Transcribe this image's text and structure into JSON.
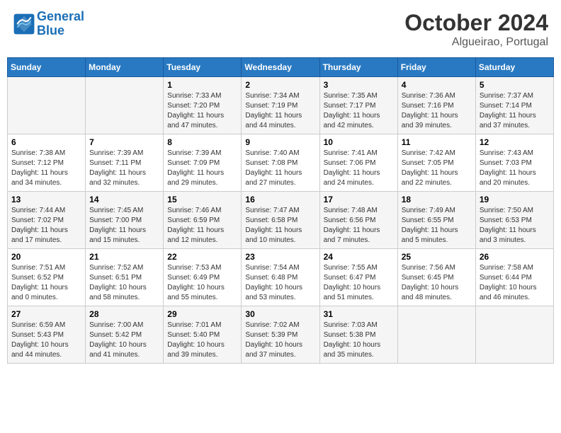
{
  "header": {
    "logo_line1": "General",
    "logo_line2": "Blue",
    "month": "October 2024",
    "location": "Algueirao, Portugal"
  },
  "days_of_week": [
    "Sunday",
    "Monday",
    "Tuesday",
    "Wednesday",
    "Thursday",
    "Friday",
    "Saturday"
  ],
  "weeks": [
    [
      {
        "day": "",
        "info": ""
      },
      {
        "day": "",
        "info": ""
      },
      {
        "day": "1",
        "info": "Sunrise: 7:33 AM\nSunset: 7:20 PM\nDaylight: 11 hours and 47 minutes."
      },
      {
        "day": "2",
        "info": "Sunrise: 7:34 AM\nSunset: 7:19 PM\nDaylight: 11 hours and 44 minutes."
      },
      {
        "day": "3",
        "info": "Sunrise: 7:35 AM\nSunset: 7:17 PM\nDaylight: 11 hours and 42 minutes."
      },
      {
        "day": "4",
        "info": "Sunrise: 7:36 AM\nSunset: 7:16 PM\nDaylight: 11 hours and 39 minutes."
      },
      {
        "day": "5",
        "info": "Sunrise: 7:37 AM\nSunset: 7:14 PM\nDaylight: 11 hours and 37 minutes."
      }
    ],
    [
      {
        "day": "6",
        "info": "Sunrise: 7:38 AM\nSunset: 7:12 PM\nDaylight: 11 hours and 34 minutes."
      },
      {
        "day": "7",
        "info": "Sunrise: 7:39 AM\nSunset: 7:11 PM\nDaylight: 11 hours and 32 minutes."
      },
      {
        "day": "8",
        "info": "Sunrise: 7:39 AM\nSunset: 7:09 PM\nDaylight: 11 hours and 29 minutes."
      },
      {
        "day": "9",
        "info": "Sunrise: 7:40 AM\nSunset: 7:08 PM\nDaylight: 11 hours and 27 minutes."
      },
      {
        "day": "10",
        "info": "Sunrise: 7:41 AM\nSunset: 7:06 PM\nDaylight: 11 hours and 24 minutes."
      },
      {
        "day": "11",
        "info": "Sunrise: 7:42 AM\nSunset: 7:05 PM\nDaylight: 11 hours and 22 minutes."
      },
      {
        "day": "12",
        "info": "Sunrise: 7:43 AM\nSunset: 7:03 PM\nDaylight: 11 hours and 20 minutes."
      }
    ],
    [
      {
        "day": "13",
        "info": "Sunrise: 7:44 AM\nSunset: 7:02 PM\nDaylight: 11 hours and 17 minutes."
      },
      {
        "day": "14",
        "info": "Sunrise: 7:45 AM\nSunset: 7:00 PM\nDaylight: 11 hours and 15 minutes."
      },
      {
        "day": "15",
        "info": "Sunrise: 7:46 AM\nSunset: 6:59 PM\nDaylight: 11 hours and 12 minutes."
      },
      {
        "day": "16",
        "info": "Sunrise: 7:47 AM\nSunset: 6:58 PM\nDaylight: 11 hours and 10 minutes."
      },
      {
        "day": "17",
        "info": "Sunrise: 7:48 AM\nSunset: 6:56 PM\nDaylight: 11 hours and 7 minutes."
      },
      {
        "day": "18",
        "info": "Sunrise: 7:49 AM\nSunset: 6:55 PM\nDaylight: 11 hours and 5 minutes."
      },
      {
        "day": "19",
        "info": "Sunrise: 7:50 AM\nSunset: 6:53 PM\nDaylight: 11 hours and 3 minutes."
      }
    ],
    [
      {
        "day": "20",
        "info": "Sunrise: 7:51 AM\nSunset: 6:52 PM\nDaylight: 11 hours and 0 minutes."
      },
      {
        "day": "21",
        "info": "Sunrise: 7:52 AM\nSunset: 6:51 PM\nDaylight: 10 hours and 58 minutes."
      },
      {
        "day": "22",
        "info": "Sunrise: 7:53 AM\nSunset: 6:49 PM\nDaylight: 10 hours and 55 minutes."
      },
      {
        "day": "23",
        "info": "Sunrise: 7:54 AM\nSunset: 6:48 PM\nDaylight: 10 hours and 53 minutes."
      },
      {
        "day": "24",
        "info": "Sunrise: 7:55 AM\nSunset: 6:47 PM\nDaylight: 10 hours and 51 minutes."
      },
      {
        "day": "25",
        "info": "Sunrise: 7:56 AM\nSunset: 6:45 PM\nDaylight: 10 hours and 48 minutes."
      },
      {
        "day": "26",
        "info": "Sunrise: 7:58 AM\nSunset: 6:44 PM\nDaylight: 10 hours and 46 minutes."
      }
    ],
    [
      {
        "day": "27",
        "info": "Sunrise: 6:59 AM\nSunset: 5:43 PM\nDaylight: 10 hours and 44 minutes."
      },
      {
        "day": "28",
        "info": "Sunrise: 7:00 AM\nSunset: 5:42 PM\nDaylight: 10 hours and 41 minutes."
      },
      {
        "day": "29",
        "info": "Sunrise: 7:01 AM\nSunset: 5:40 PM\nDaylight: 10 hours and 39 minutes."
      },
      {
        "day": "30",
        "info": "Sunrise: 7:02 AM\nSunset: 5:39 PM\nDaylight: 10 hours and 37 minutes."
      },
      {
        "day": "31",
        "info": "Sunrise: 7:03 AM\nSunset: 5:38 PM\nDaylight: 10 hours and 35 minutes."
      },
      {
        "day": "",
        "info": ""
      },
      {
        "day": "",
        "info": ""
      }
    ]
  ]
}
